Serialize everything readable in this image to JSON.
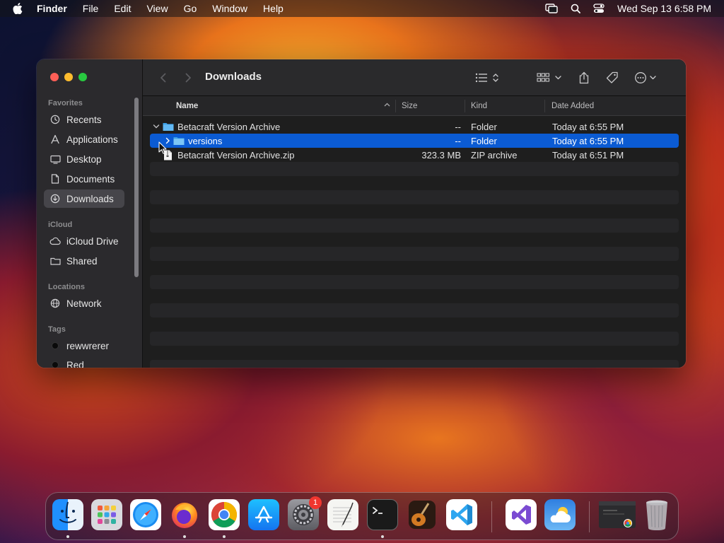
{
  "menubar": {
    "app_name": "Finder",
    "items": [
      "File",
      "Edit",
      "View",
      "Go",
      "Window",
      "Help"
    ],
    "clock": "Wed Sep 13  6:58 PM"
  },
  "window": {
    "title": "Downloads",
    "sidebar": {
      "favorites_label": "Favorites",
      "favorites": [
        {
          "label": "Recents",
          "icon": "clock-icon"
        },
        {
          "label": "Applications",
          "icon": "applications-icon"
        },
        {
          "label": "Desktop",
          "icon": "desktop-icon"
        },
        {
          "label": "Documents",
          "icon": "document-icon"
        },
        {
          "label": "Downloads",
          "icon": "download-icon",
          "selected": true
        }
      ],
      "icloud_label": "iCloud",
      "icloud": [
        {
          "label": "iCloud Drive",
          "icon": "cloud-icon"
        },
        {
          "label": "Shared",
          "icon": "shared-folder-icon"
        }
      ],
      "locations_label": "Locations",
      "locations": [
        {
          "label": "Network",
          "icon": "globe-icon"
        }
      ],
      "tags_label": "Tags",
      "tags": [
        {
          "label": "rewwrerer",
          "color": "#0a0a0a"
        },
        {
          "label": "Red",
          "color": "#0a0a0a"
        }
      ]
    },
    "columns": {
      "name": "Name",
      "size": "Size",
      "kind": "Kind",
      "date_added": "Date Added"
    },
    "files": [
      {
        "name": "Betacraft Version Archive",
        "size": "--",
        "kind": "Folder",
        "date_added": "Today at 6:55 PM",
        "type": "folder",
        "expanded": true,
        "level": 0
      },
      {
        "name": "versions",
        "size": "--",
        "kind": "Folder",
        "date_added": "Today at 6:55 PM",
        "type": "folder",
        "expanded": false,
        "level": 1,
        "selected": true
      },
      {
        "name": "Betacraft Version Archive.zip",
        "size": "323.3 MB",
        "kind": "ZIP archive",
        "date_added": "Today at 6:51 PM",
        "type": "zip",
        "level": 0
      }
    ]
  },
  "dock": {
    "apps": [
      "Finder",
      "Launchpad",
      "Safari",
      "Firefox",
      "Chrome",
      "App Store",
      "System Settings",
      "TextEdit",
      "Terminal",
      "GarageBand",
      "Visual Studio Code",
      "Visual Studio",
      "Weather",
      "Chrome Window",
      "Trash"
    ],
    "settings_badge": "1"
  },
  "colors": {
    "selection": "#0b5bd3",
    "sidebar_bg": "#2b2a2d",
    "window_bg": "#1e1e1e"
  }
}
